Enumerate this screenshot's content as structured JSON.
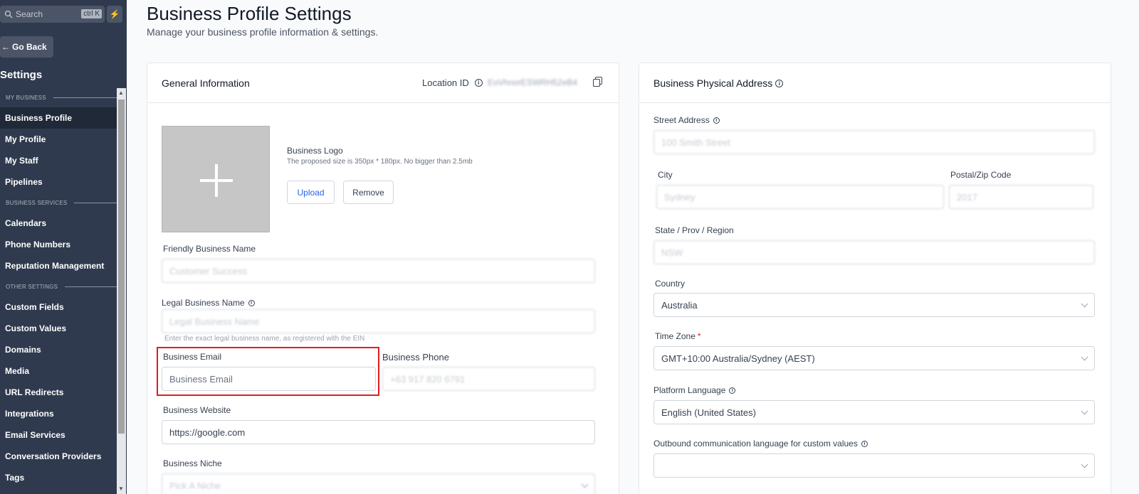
{
  "sidebar": {
    "search_placeholder": "Search",
    "search_shortcut": "ctrl K",
    "go_back": "Go Back",
    "title": "Settings",
    "sections": {
      "my_business": "MY BUSINESS",
      "business_services": "BUSINESS SERVICES",
      "other_settings": "OTHER SETTINGS"
    },
    "items": [
      {
        "label": "Business Profile"
      },
      {
        "label": "My Profile"
      },
      {
        "label": "My Staff"
      },
      {
        "label": "Pipelines"
      },
      {
        "label": "Calendars"
      },
      {
        "label": "Phone Numbers"
      },
      {
        "label": "Reputation Management"
      },
      {
        "label": "Custom Fields"
      },
      {
        "label": "Custom Values"
      },
      {
        "label": "Domains"
      },
      {
        "label": "Media"
      },
      {
        "label": "URL Redirects"
      },
      {
        "label": "Integrations"
      },
      {
        "label": "Email Services"
      },
      {
        "label": "Conversation Providers"
      },
      {
        "label": "Tags"
      }
    ]
  },
  "header": {
    "title": "Business Profile Settings",
    "subtitle": "Manage your business profile information & settings."
  },
  "general": {
    "title": "General Information",
    "location_id_label": "Location ID",
    "location_id_value": "EoVhnorESWRH52eB4",
    "logo_label": "Business Logo",
    "logo_hint": "The proposed size is 350px * 180px. No bigger than 2.5mb",
    "upload": "Upload",
    "remove": "Remove",
    "friendly_name_label": "Friendly Business Name",
    "friendly_name_value": "Customer Success",
    "legal_name_label": "Legal Business Name",
    "legal_name_placeholder": "Legal Business Name",
    "legal_name_hint": "Enter the exact legal business name, as registered with the EIN",
    "email_label": "Business Email",
    "email_placeholder": "Business Email",
    "phone_label": "Business Phone",
    "phone_value": "+63 917 820 6791",
    "website_label": "Business Website",
    "website_value": "https://google.com",
    "niche_label": "Business Niche",
    "niche_placeholder": "Pick A Niche"
  },
  "address": {
    "title": "Business Physical Address",
    "street_label": "Street Address",
    "street_value": "100 Smith Street",
    "city_label": "City",
    "city_value": "Sydney",
    "zip_label": "Postal/Zip Code",
    "zip_value": "2017",
    "state_label": "State / Prov / Region",
    "state_value": "NSW",
    "country_label": "Country",
    "country_value": "Australia",
    "timezone_label": "Time Zone",
    "timezone_required": "*",
    "timezone_value": "GMT+10:00 Australia/Sydney (AEST)",
    "platform_language_label": "Platform Language",
    "platform_language_value": "English (United States)",
    "outbound_language_label": "Outbound communication language for custom values",
    "outbound_language_value": ""
  },
  "colors": {
    "sidebar_bg": "#2f3a4e",
    "sidebar_active": "#1f2937",
    "accent_blue": "#2563eb",
    "highlight_red": "#e11d1d"
  }
}
